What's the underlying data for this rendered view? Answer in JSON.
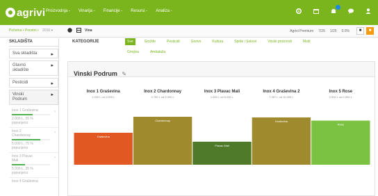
{
  "app": {
    "logo_text": "agrivi",
    "nav": [
      "Proizvodnja -",
      "Vinarija -",
      "Financije -",
      "Resursi -",
      "Analiza -"
    ],
    "icons": [
      "gear-icon",
      "calendar-icon",
      "bell-icon",
      "chat-icon",
      "user-icon"
    ]
  },
  "toolbar": {
    "breadcrumb": "Početna • Pocetni •",
    "sep": "2016 ▾",
    "help_label": "?",
    "view_label": "Vina",
    "stats": [
      "Agrivi Premium",
      "7/25",
      "1/25",
      "0.0%"
    ],
    "btn_print": "■",
    "btn_orange": "■"
  },
  "sidebar": {
    "title": "SKLADIŠTA",
    "items": [
      {
        "label": "Sva skladišta",
        "arrow": "▸"
      },
      {
        "label": "Glavno skladište",
        "arrow": "▸"
      },
      {
        "label": "Pesticidi",
        "arrow": "▸"
      },
      {
        "label": "Vinski Podrum",
        "arrow": "▸"
      }
    ],
    "subitems": [
      {
        "name": "Inox 1 Graševina",
        "fill": 0.55,
        "value": "2.000 L, 55 %",
        "sub": "popunjeno"
      },
      {
        "name": "Inox 2 Chardonnay",
        "fill": 0.75,
        "value": "5.000 L, 75 %",
        "sub": "popunjeno"
      },
      {
        "name": "Inox 3 Plavac Mali",
        "fill": 0.35,
        "value": "5.000 L, 35 %",
        "sub": "popunjeno"
      },
      {
        "name": "Inox 4 Graševina",
        "fill": 0.0,
        "value": "",
        "sub": ""
      }
    ]
  },
  "categories": {
    "label": "KATEGORIJE",
    "row1": [
      "Sve",
      "Grožđe",
      "Pesticidi",
      "Gorivo",
      "Kultura",
      "Sprite i Sokovi",
      "Vinski proizvodi",
      "Mošt"
    ],
    "row2": [
      "Gnojiva",
      "Ambalaža"
    ]
  },
  "panel": {
    "title": "Vinski Podrum",
    "edit_icon": "pencil-icon"
  },
  "chart_data": {
    "type": "bar",
    "categories": [
      "Inox 1 Graševina",
      "Inox 2 Chardonnay",
      "Inox 3 Plavac Mali",
      "Inox 4 Graševina 2",
      "Inox 5 Rose"
    ],
    "sublabels": [
      "1.000 L od 2.000 L",
      "3.750 L od 5.000 L",
      "1.800 L od 5.000 L",
      "7.387 L od 10.000 L",
      "2.500 L od 2.900 L"
    ],
    "bar_labels": [
      "Graševina",
      "Chardonnay",
      "Plavac Mali",
      "Graševina",
      "Rose"
    ],
    "values": [
      0.5,
      0.75,
      0.36,
      0.74,
      0.69
    ],
    "colors": [
      "#e25822",
      "#a08a2e",
      "#4e7a2a",
      "#a08a2e",
      "#7cc242"
    ],
    "ylim": [
      0,
      1
    ]
  }
}
